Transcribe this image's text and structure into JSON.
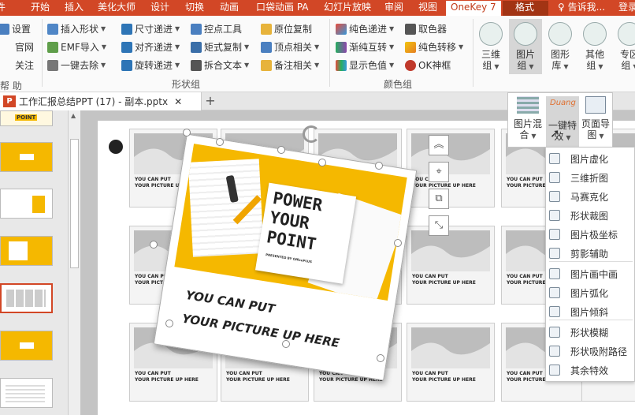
{
  "tabs": [
    "开始",
    "插入",
    "美化大师",
    "设计",
    "切换",
    "动画",
    "口袋动画 PA",
    "幻灯片放映",
    "审阅",
    "视图",
    "OneKey 7",
    "格式",
    "告诉我...",
    "登录"
  ],
  "ribbon": {
    "left_items": [
      "设置",
      "官网",
      "关注"
    ],
    "help_group": "帮 助",
    "shape_col1": [
      "插入形状",
      "EMF导入",
      "一键去除"
    ],
    "shape_col2": [
      "尺寸递进",
      "对齐递进",
      "旋转递进"
    ],
    "shape_col3": [
      "控点工具",
      "矩式复制",
      "拆合文本"
    ],
    "shape_col4": [
      "原位复制",
      "顶点相关",
      "备注相关"
    ],
    "shape_group": "形状组",
    "color_col1": [
      "纯色递进",
      "渐纯互转",
      "显示色值"
    ],
    "color_col2": [
      "取色器",
      "纯色转移",
      "OK神框"
    ],
    "color_group": "颜色组",
    "big_buttons": [
      [
        "三维",
        "组"
      ],
      [
        "图片",
        "组"
      ],
      [
        "图形",
        "库"
      ],
      [
        "其他",
        "组"
      ],
      [
        "专区",
        "组"
      ]
    ],
    "right_tail": "属"
  },
  "popup": {
    "buttons": [
      [
        "图片混",
        "合"
      ],
      [
        "一键特",
        "效"
      ],
      [
        "页面导",
        "图"
      ]
    ],
    "brand": "Duang"
  },
  "doc": {
    "title": "工作汇报总结PPT (17) - 副本.pptx",
    "ppt_icon": "P"
  },
  "slide": {
    "card_text": [
      "YOU CAN PUT",
      "YOUR PICTURE UP HERE"
    ],
    "hero_title": [
      "POWER",
      "YOUR",
      "POINT"
    ],
    "hero_small": "PRESENTED BY OfficePLUS",
    "hero_text": [
      "YOU CAN PUT",
      "YOUR PICTURE UP HERE"
    ],
    "thumb_badge": "POINT"
  },
  "menu": [
    "图片虚化",
    "三维折图",
    "马赛克化",
    "形状裁图",
    "图片极坐标",
    "剪影辅助",
    "图片画中画",
    "图片弧化",
    "图片倾斜",
    "形状模糊",
    "形状吸附路径",
    "其余特效"
  ],
  "colors": {
    "accent": "#d24726",
    "yellow": "#f5b800"
  }
}
